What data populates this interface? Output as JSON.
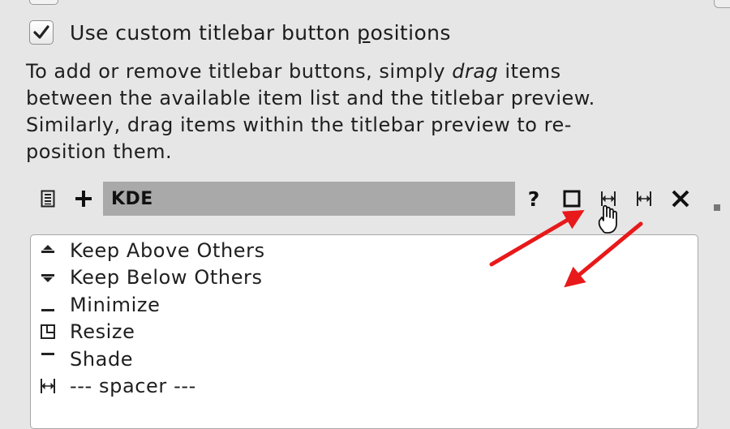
{
  "checkbox": {
    "label_before": "Use custom titlebar button ",
    "label_mnemonic": "p",
    "label_after": "ositions",
    "checked": true
  },
  "info": {
    "line1_before": "To add or remove titlebar buttons, simply ",
    "line1_em": "drag",
    "line1_after": " items",
    "line2": "between the available item list and the titlebar preview.",
    "line3": "Similarly, drag items within the titlebar preview to re-",
    "line4": "position them."
  },
  "toolbar": {
    "title": "KDE",
    "left_icons": [
      "menu-icon",
      "plus-icon"
    ],
    "right_icons": [
      "help-icon",
      "maximize-icon",
      "spacer-icon",
      "spacer-icon",
      "close-icon"
    ],
    "help_glyph": "?"
  },
  "items": [
    {
      "label": "Keep Above Others",
      "icon": "keep-above-icon"
    },
    {
      "label": "Keep Below Others",
      "icon": "keep-below-icon"
    },
    {
      "label": "Minimize",
      "icon": "minimize-icon"
    },
    {
      "label": "Resize",
      "icon": "resize-icon"
    },
    {
      "label": "Shade",
      "icon": "shade-icon"
    },
    {
      "label": "--- spacer ---",
      "icon": "spacer-icon"
    }
  ],
  "colors": {
    "background": "#e6e6e6",
    "preview": "#a9a9a9",
    "arrow": "#e8191a"
  }
}
